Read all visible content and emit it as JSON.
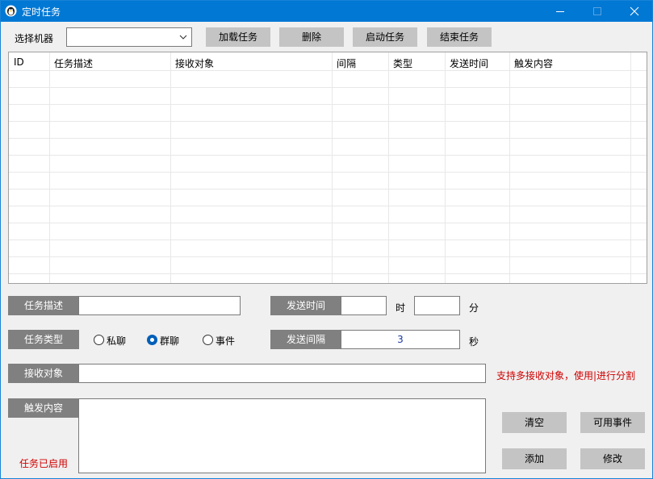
{
  "window": {
    "title": "定时任务",
    "accent": "#0078d4"
  },
  "toolbar": {
    "machine_label": "选择机器",
    "machine_value": "",
    "load_label": "加载任务",
    "delete_label": "删除",
    "start_label": "启动任务",
    "stop_label": "结束任务"
  },
  "table": {
    "columns": [
      "ID",
      "任务描述",
      "接收对象",
      "间隔",
      "类型",
      "发送时间",
      "触发内容"
    ],
    "rows": []
  },
  "form": {
    "desc_label": "任务描述",
    "desc_value": "",
    "send_time_label": "发送时间",
    "hour_value": "",
    "hour_unit": "时",
    "minute_value": "",
    "minute_unit": "分",
    "type_label": "任务类型",
    "type_options": [
      "私聊",
      "群聊",
      "事件"
    ],
    "type_selected": "群聊",
    "interval_label": "发送间隔",
    "interval_value": "3",
    "interval_unit": "秒",
    "receiver_label": "接收对象",
    "receiver_value": "",
    "receiver_hint": "支持多接收对象，使用|进行分割",
    "content_label": "触发内容",
    "content_value": "",
    "status_text": "任务已启用"
  },
  "actions": {
    "clear_label": "清空",
    "events_label": "可用事件",
    "add_label": "添加",
    "modify_label": "修改"
  }
}
